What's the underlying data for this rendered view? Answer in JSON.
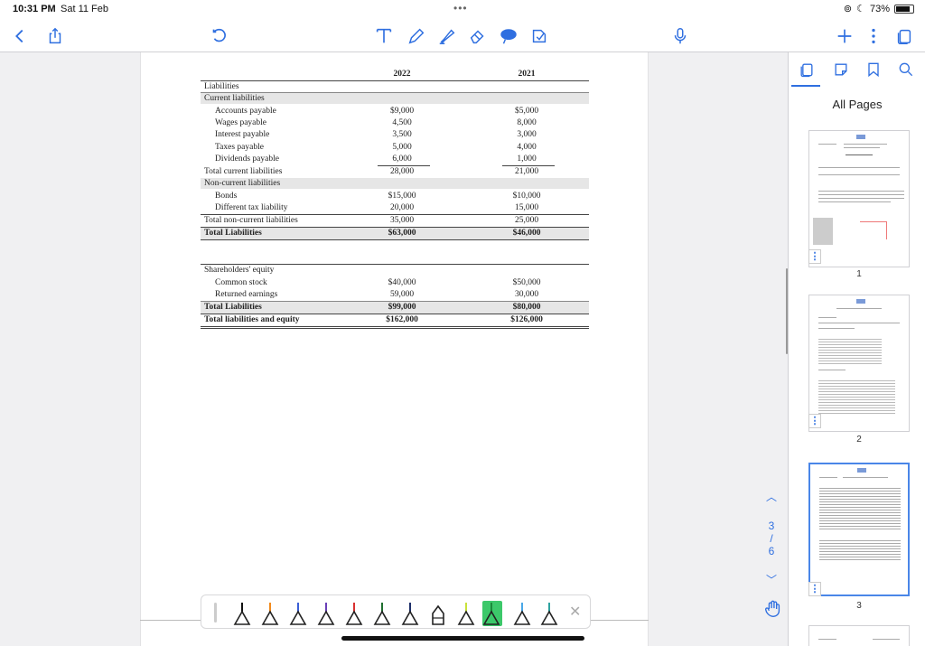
{
  "status": {
    "time": "10:31 PM",
    "date": "Sat 11 Feb",
    "battery": "73%"
  },
  "toolbar": {
    "icons": [
      "back-icon",
      "share-icon",
      "undo-icon",
      "text-tool-icon",
      "pen-tool-icon",
      "highlighter-icon",
      "eraser-icon",
      "lasso-icon",
      "sticker-icon",
      "mic-icon",
      "add-icon",
      "more-icon",
      "page-view-icon"
    ]
  },
  "statement": {
    "year1": "2022",
    "year2": "2021",
    "liabilities_heading": "Liabilities",
    "current_heading": "Current liabilities",
    "current_rows": [
      {
        "label": "Accounts payable",
        "y1": "$9,000",
        "y2": "$5,000"
      },
      {
        "label": "Wages payable",
        "y1": "4,500",
        "y2": "8,000"
      },
      {
        "label": "Interest payable",
        "y1": "3,500",
        "y2": "3,000"
      },
      {
        "label": "Taxes payable",
        "y1": "5,000",
        "y2": "4,000"
      },
      {
        "label": "Dividends payable",
        "y1": "6,000",
        "y2": "1,000"
      }
    ],
    "total_current": {
      "label": "Total current liabilities",
      "y1": "28,000",
      "y2": "21,000"
    },
    "noncurrent_heading": "Non-current liabilities",
    "noncurrent_rows": [
      {
        "label": "Bonds",
        "y1": "$15,000",
        "y2": "$10,000"
      },
      {
        "label": "Different tax liability",
        "y1": "20,000",
        "y2": "15,000"
      }
    ],
    "total_noncurrent": {
      "label": "Total non-current liabilities",
      "y1": "35,000",
      "y2": "25,000"
    },
    "total_liabilities": {
      "label": "Total Liabilities",
      "y1": "$63,000",
      "y2": "$46,000"
    },
    "equity_heading": "Shareholders' equity",
    "equity_rows": [
      {
        "label": "Common stock",
        "y1": "$40,000",
        "y2": "$50,000"
      },
      {
        "label": "Returned earnings",
        "y1": "59,000",
        "y2": "30,000"
      }
    ],
    "total_equity": {
      "label": "Total Liabilities",
      "y1": "$99,000",
      "y2": "$80,000"
    },
    "total_liab_equity": {
      "label": "Total liabilities and equity",
      "y1": "$162,000",
      "y2": "$126,000"
    }
  },
  "pager": {
    "current": "3",
    "separator": "/",
    "total": "6"
  },
  "sidebar": {
    "title": "All Pages",
    "pages": [
      {
        "number": "1"
      },
      {
        "number": "2"
      },
      {
        "number": "3"
      }
    ],
    "menu_glyph": "⋮"
  },
  "pentray": {
    "close": "✕"
  }
}
